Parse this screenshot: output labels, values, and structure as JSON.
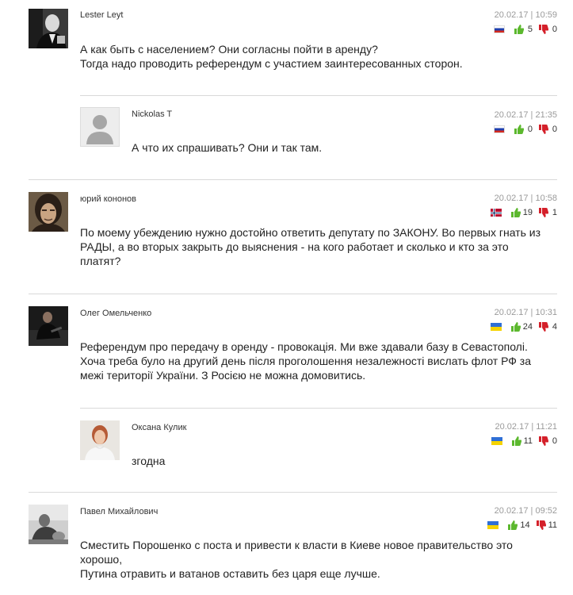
{
  "comments": [
    {
      "author": "Lester Leyt",
      "date": "20.02.17 | 10:59",
      "flag": "ru",
      "likes": "5",
      "dislikes": "0",
      "lines": [
        "А как быть с населением? Они согласны пойти в аренду?",
        "Тогда надо проводить референдум с участием заинтересованных сторон."
      ]
    },
    {
      "author": "Nickolas T",
      "date": "20.02.17 | 21:35",
      "flag": "ru",
      "likes": "0",
      "dislikes": "0",
      "lines": [
        "А что их спрашивать? Они и так там."
      ]
    },
    {
      "author": "юрий кононов",
      "date": "20.02.17 | 10:58",
      "flag": "no",
      "likes": "19",
      "dislikes": "1",
      "lines": [
        "По моему убеждению нужно достойно ответить депутату по ЗАКОНУ. Во первых гнать из",
        "РАДЫ, а во вторых закрыть до выяснения - на кого работает и сколько и кто за это",
        "платят?"
      ]
    },
    {
      "author": "Олег Омельченко",
      "date": "20.02.17 | 10:31",
      "flag": "ua",
      "likes": "24",
      "dislikes": "4",
      "lines": [
        "Референдум про передачу в оренду - провокація. Ми вже здавали базу в Севастополі.",
        "Хоча треба було на другий день після проголошення незалежності вислать флот РФ за",
        "межі території України. З Росією не можна домовитись."
      ]
    },
    {
      "author": "Оксана Кулик",
      "date": "20.02.17 | 11:21",
      "flag": "ua",
      "likes": "11",
      "dislikes": "0",
      "lines": [
        "згодна"
      ]
    },
    {
      "author": "Павел Михайлович",
      "date": "20.02.17 | 09:52",
      "flag": "ua",
      "likes": "14",
      "dislikes": "11",
      "lines": [
        "Сместить Порошенко с поста и привести к власти в Киеве новое правительство это",
        "хорошо,",
        "Путина отравить и ватанов оставить без царя еще лучше."
      ]
    }
  ]
}
